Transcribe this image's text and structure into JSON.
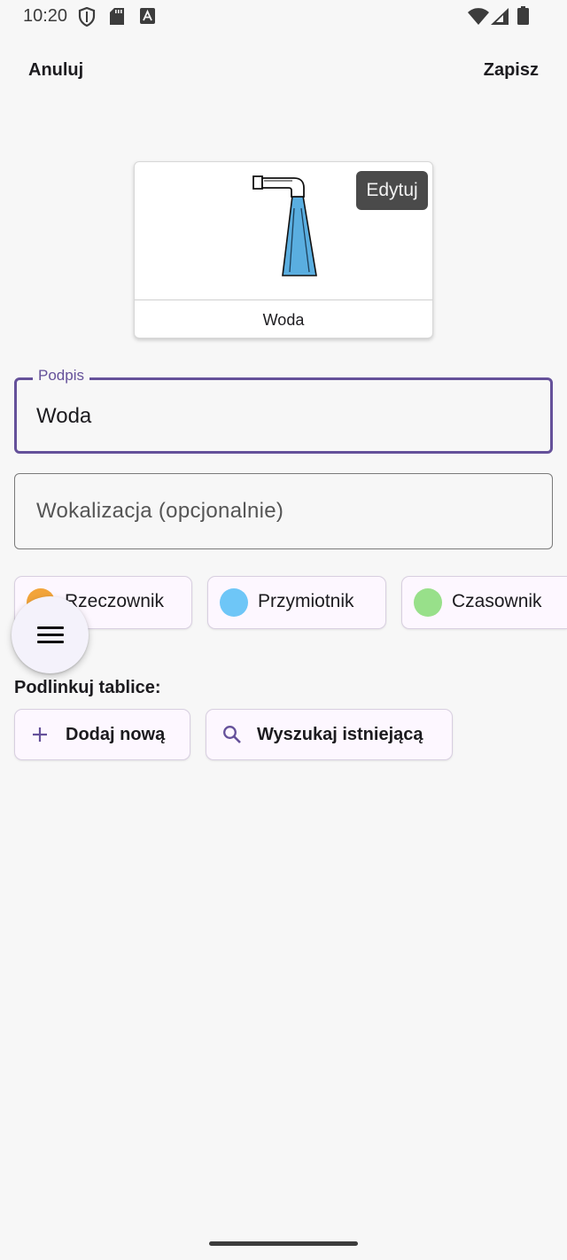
{
  "status_bar": {
    "time": "10:20",
    "icons": [
      "shield-icon",
      "sd-card-icon",
      "font-a-icon",
      "wifi-icon",
      "signal-icon",
      "battery-icon"
    ]
  },
  "top_bar": {
    "cancel_label": "Anuluj",
    "save_label": "Zapisz"
  },
  "card": {
    "image_icon": "water-tap-icon",
    "edit_label": "Edytuj",
    "label": "Woda"
  },
  "fields": {
    "caption": {
      "label": "Podpis",
      "value": "Woda"
    },
    "vocalization": {
      "placeholder": "Wokalizacja (opcjonalnie)"
    }
  },
  "categories": [
    {
      "label": "Rzeczownik",
      "color": "#f2a43a"
    },
    {
      "label": "Przymiotnik",
      "color": "#6ec6f7"
    },
    {
      "label": "Czasownik",
      "color": "#98e08a"
    }
  ],
  "link_boards": {
    "title": "Podlinkuj tablice:",
    "add_new_label": "Dodaj nową",
    "search_label": "Wyszukaj istniejącą"
  },
  "colors": {
    "accent": "#65519a",
    "chip_background": "#fdf7ff",
    "water": "#5aaee0"
  }
}
